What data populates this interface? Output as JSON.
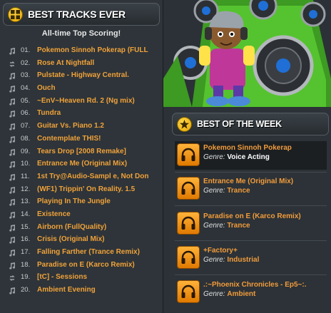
{
  "top_tracks": {
    "title": "BEST TRACKS EVER",
    "subtitle": "All-time Top Scoring!",
    "items": [
      {
        "num": "01.",
        "name": "Pokemon Sinnoh Pokerap (FULL",
        "icon": "music-note-icon"
      },
      {
        "num": "02.",
        "name": "Rose At Nightfall",
        "icon": "loop-icon"
      },
      {
        "num": "03.",
        "name": "Pulstate - Highway Central.",
        "icon": "music-note-icon"
      },
      {
        "num": "04.",
        "name": "Ouch",
        "icon": "music-note-icon"
      },
      {
        "num": "05.",
        "name": "~EnV~Heaven Rd. 2 (Ng mix)",
        "icon": "music-note-icon"
      },
      {
        "num": "06.",
        "name": "Tundra",
        "icon": "music-note-icon"
      },
      {
        "num": "07.",
        "name": "Guitar Vs. Piano 1.2",
        "icon": "music-note-icon"
      },
      {
        "num": "08.",
        "name": "Contemplate THIS!",
        "icon": "music-note-icon"
      },
      {
        "num": "09.",
        "name": "Tears Drop [2008 Remake]",
        "icon": "music-note-icon"
      },
      {
        "num": "10.",
        "name": "Entrance Me (Original Mix)",
        "icon": "music-note-icon"
      },
      {
        "num": "11.",
        "name": "1st Try@Audio-Sampl e, Not Don",
        "icon": "music-note-icon"
      },
      {
        "num": "12.",
        "name": "(WF1) Trippin' On Reality. 1.5",
        "icon": "music-note-icon"
      },
      {
        "num": "13.",
        "name": "Playing In The Jungle",
        "icon": "music-note-icon"
      },
      {
        "num": "14.",
        "name": "Existence",
        "icon": "music-note-icon"
      },
      {
        "num": "15.",
        "name": "Airborn (FullQuality)",
        "icon": "music-note-icon"
      },
      {
        "num": "16.",
        "name": "Crisis (Original Mix)",
        "icon": "music-note-icon"
      },
      {
        "num": "17.",
        "name": "Falling Farther (Trance Remix)",
        "icon": "music-note-icon"
      },
      {
        "num": "18.",
        "name": "Paradise on E (Karco Remix)",
        "icon": "music-note-icon"
      },
      {
        "num": "19.",
        "name": "[tC] - Sessions",
        "icon": "loop-icon"
      },
      {
        "num": "20.",
        "name": "Ambient Evening",
        "icon": "music-note-icon"
      }
    ]
  },
  "best_week": {
    "title": "BEST OF THE WEEK",
    "genre_label": "Genre:",
    "items": [
      {
        "title": "Pokemon Sinnoh Pokerap",
        "genre": "Voice Acting"
      },
      {
        "title": "Entrance Me (Original Mix)",
        "genre": "Trance"
      },
      {
        "title": "Paradise on E (Karco Remix)",
        "genre": "Trance"
      },
      {
        "title": "+Factory+",
        "genre": "Industrial"
      },
      {
        "title": ".:~Phoenix Chronicles - Ep5~:.",
        "genre": "Ambient"
      }
    ]
  },
  "colors": {
    "accent": "#f29c3c",
    "panel_bg": "#2e3439",
    "speaker_green": "#4fbf2a"
  }
}
